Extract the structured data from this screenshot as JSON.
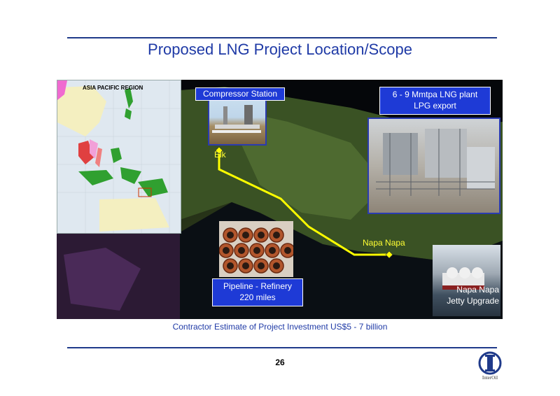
{
  "slide": {
    "title": "Proposed LNG Project Location/Scope",
    "caption": "Contractor Estimate of Project Investment US$5 - 7 billion",
    "page_number": "26"
  },
  "map": {
    "inset_title": "ASIA PACIFIC REGION",
    "compressor_label": "Compressor Station",
    "lng_plant_line1": "6 - 9  Mmtpa LNG plant",
    "lng_plant_line2": "LPG export",
    "elk_label": "Elk",
    "napa_label": "Napa Napa",
    "pipeline_line1": "Pipeline - Refinery",
    "pipeline_line2": "220 miles",
    "jetty_line1": "Napa Napa",
    "jetty_line2": "Jetty Upgrade",
    "route_color": "#ffff00"
  },
  "logo": {
    "text": "InterOil",
    "icon": "interoil-logo-icon"
  }
}
